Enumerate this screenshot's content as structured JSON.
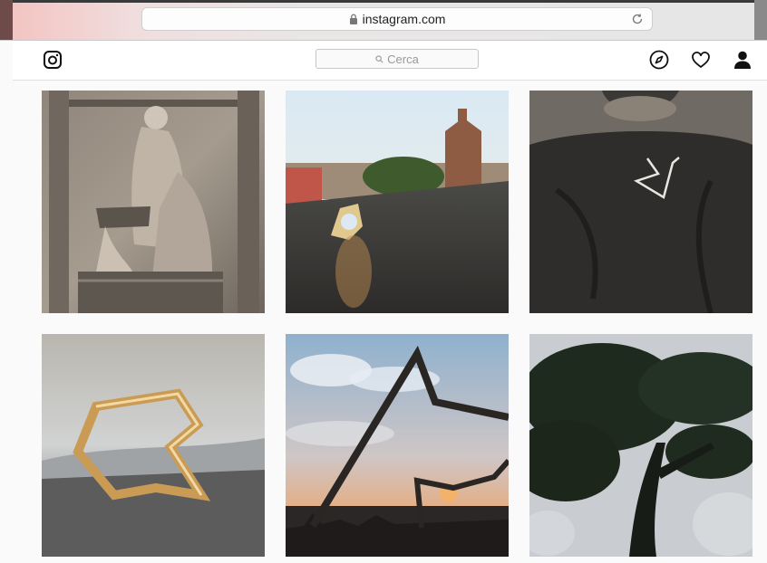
{
  "browser": {
    "url": "instagram.com",
    "lock_icon": "lock-icon",
    "reload_icon": "reload-icon"
  },
  "nav": {
    "logo_icon": "instagram-logo-icon",
    "search_placeholder": "Cerca",
    "icons": [
      "compass-icon",
      "heart-icon",
      "profile-icon"
    ]
  },
  "grid": {
    "posts": [
      {
        "subject": "marble relief"
      },
      {
        "subject": "ring on ledge"
      },
      {
        "subject": "necklace on black top"
      },
      {
        "subject": "gold ring"
      },
      {
        "subject": "star sculpture at sunset"
      },
      {
        "subject": "tree silhouette"
      }
    ]
  },
  "colors": {
    "page_bg": "#fafafa",
    "nav_bg": "#ffffff",
    "border": "#e0e0e0"
  }
}
